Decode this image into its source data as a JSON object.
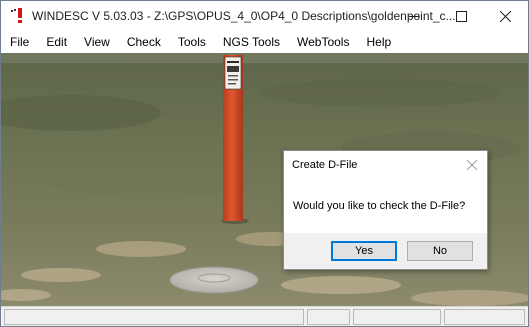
{
  "window": {
    "title": "WINDESC V 5.03.03 - Z:\\GPS\\OPUS_4_0\\OP4_0 Descriptions\\goldenpoint_c...",
    "app_icon": "red-exclamation-icon",
    "controls": [
      "minimize-icon",
      "maximize-icon",
      "close-icon"
    ]
  },
  "menu": {
    "items": [
      "File",
      "Edit",
      "View",
      "Check",
      "Tools",
      "NGS Tools",
      "WebTools",
      "Help"
    ]
  },
  "photo": {
    "subject": "orange survey marker post with sign and round disk in grass field",
    "colors": {
      "post": "#d4502a",
      "grass": "#6a7152",
      "disk": "#c9c6bf"
    }
  },
  "dialog": {
    "title": "Create D-File",
    "message": "Would you like to check the D-File?",
    "buttons": {
      "yes": "Yes",
      "no": "No"
    },
    "default_button": "Yes",
    "accent": "#0078d7"
  },
  "statusbar": {
    "panes": [
      "",
      "",
      "",
      ""
    ]
  }
}
